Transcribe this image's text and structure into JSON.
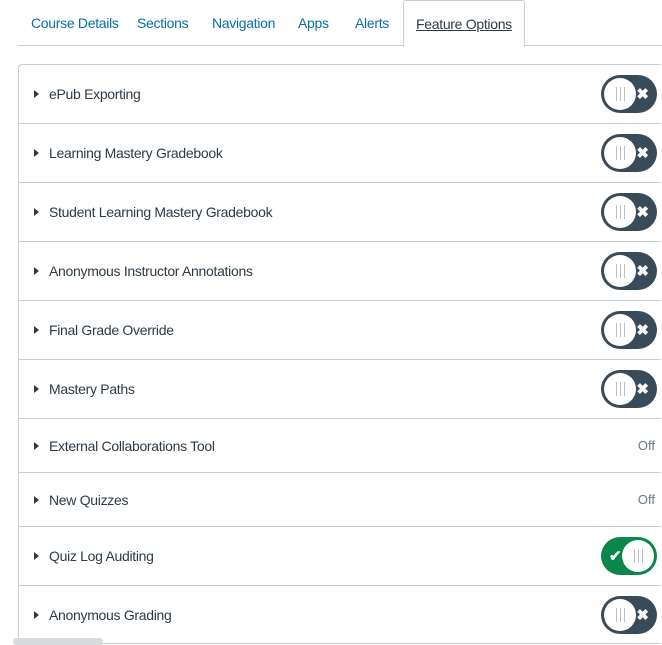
{
  "tabs": [
    {
      "label": "Course Details",
      "active": false
    },
    {
      "label": "Sections",
      "active": false
    },
    {
      "label": "Navigation",
      "active": false
    },
    {
      "label": "Apps",
      "active": false
    },
    {
      "label": "Alerts",
      "active": false
    },
    {
      "label": "Feature Options",
      "active": true
    }
  ],
  "features": [
    {
      "name": "ePub Exporting",
      "state": "toggle-off"
    },
    {
      "name": "Learning Mastery Gradebook",
      "state": "toggle-off"
    },
    {
      "name": "Student Learning Mastery Gradebook",
      "state": "toggle-off"
    },
    {
      "name": "Anonymous Instructor Annotations",
      "state": "toggle-off"
    },
    {
      "name": "Final Grade Override",
      "state": "toggle-off"
    },
    {
      "name": "Mastery Paths",
      "state": "toggle-off"
    },
    {
      "name": "External Collaborations Tool",
      "state": "text",
      "state_text": "Off"
    },
    {
      "name": "New Quizzes",
      "state": "text",
      "state_text": "Off"
    },
    {
      "name": "Quiz Log Auditing",
      "state": "toggle-on"
    },
    {
      "name": "Anonymous Grading",
      "state": "toggle-off"
    }
  ],
  "colors": {
    "link": "#0770a3",
    "toggle_off": "#394b58",
    "toggle_on": "#0b874b",
    "border": "#c7cdd1"
  },
  "icons": {
    "expand": "caret-right-icon",
    "off": "x-icon",
    "on": "checkmark-icon"
  }
}
